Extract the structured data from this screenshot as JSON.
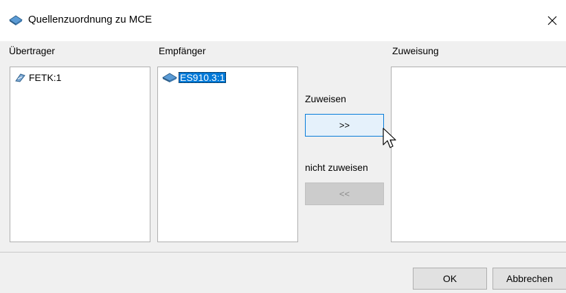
{
  "window": {
    "title": "Quellenzuordnung zu MCE",
    "title_icon": "mce-module-icon",
    "close_glyph": "✕"
  },
  "columns": {
    "transmitter": {
      "label": "Übertrager",
      "items": [
        {
          "label": "FETK:1",
          "icon": "fetk-device-icon"
        }
      ]
    },
    "receiver": {
      "label": "Empfänger",
      "items": [
        {
          "label": "ES910.3:1",
          "icon": "es910-module-icon",
          "selected": true
        }
      ]
    },
    "assignment": {
      "label": "Zuweisung",
      "items": []
    }
  },
  "actions": {
    "assign_label": "Zuweisen",
    "assign_button": ">>",
    "unassign_label": "nicht zuweisen",
    "unassign_button": "<<"
  },
  "footer": {
    "ok": "OK",
    "cancel": "Abbrechen"
  },
  "colors": {
    "selection": "#0078d7",
    "dialog_background": "#f0f0f0",
    "hover_button_fill": "#e5f1fb"
  }
}
